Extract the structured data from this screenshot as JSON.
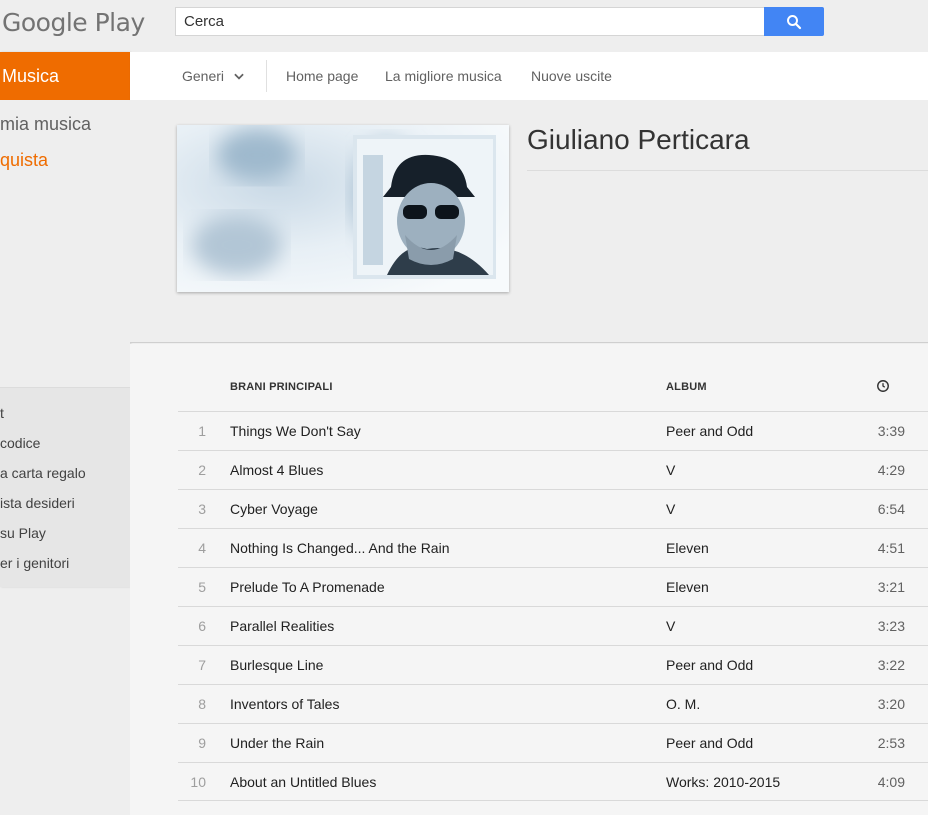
{
  "header": {
    "logo": "Google Play",
    "search_placeholder": "Cerca",
    "search_button_color": "#4285f4"
  },
  "sidebar": {
    "section": "Musica",
    "section_color": "#ef6c00",
    "items": [
      "mia musica",
      "quista"
    ],
    "links": [
      "t",
      "codice",
      "a carta regalo",
      "ista desideri",
      "su Play",
      "er i genitori"
    ]
  },
  "nav": {
    "genres": "Generi",
    "links": [
      "Home page",
      "La migliore musica",
      "Nuove uscite"
    ]
  },
  "artist": {
    "name": "Giuliano Perticara"
  },
  "tracks": {
    "headers": {
      "title": "BRANI PRINCIPALI",
      "album": "ALBUM",
      "duration_icon": "clock-icon"
    },
    "rows": [
      {
        "num": "1",
        "title": "Things We Don't Say",
        "album": "Peer and Odd",
        "duration": "3:39"
      },
      {
        "num": "2",
        "title": "Almost 4 Blues",
        "album": "V",
        "duration": "4:29"
      },
      {
        "num": "3",
        "title": "Cyber Voyage",
        "album": "V",
        "duration": "6:54"
      },
      {
        "num": "4",
        "title": "Nothing Is Changed... And the Rain",
        "album": "Eleven",
        "duration": "4:51"
      },
      {
        "num": "5",
        "title": "Prelude To A Promenade",
        "album": "Eleven",
        "duration": "3:21"
      },
      {
        "num": "6",
        "title": "Parallel Realities",
        "album": "V",
        "duration": "3:23"
      },
      {
        "num": "7",
        "title": "Burlesque Line",
        "album": "Peer and Odd",
        "duration": "3:22"
      },
      {
        "num": "8",
        "title": "Inventors of Tales",
        "album": "O. M.",
        "duration": "3:20"
      },
      {
        "num": "9",
        "title": "Under the Rain",
        "album": "Peer and Odd",
        "duration": "2:53"
      },
      {
        "num": "10",
        "title": "About an Untitled Blues",
        "album": "Works: 2010-2015",
        "duration": "4:09"
      }
    ]
  }
}
